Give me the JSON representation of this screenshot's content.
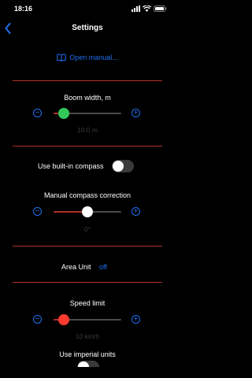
{
  "status": {
    "time": "18:16"
  },
  "nav": {
    "title": "Settings"
  },
  "manual": {
    "label": "Open manual..."
  },
  "boom": {
    "label": "Boom width, m",
    "value": "10.0 m",
    "fraction": 0.15,
    "thumb_color": "#33c759"
  },
  "compass": {
    "label": "Use built-in compass",
    "on": false
  },
  "correction": {
    "label": "Manual compass correction",
    "value": "0°",
    "fraction": 0.5,
    "thumb_color": "#ffffff"
  },
  "area": {
    "label": "Area Unit",
    "value": "off"
  },
  "speed": {
    "label": "Speed limit",
    "value": "10 km/h",
    "fraction": 0.15,
    "thumb_color": "#ff3b30"
  },
  "imperial": {
    "label": "Use imperial units"
  },
  "colors": {
    "accent": "#1e6ff0",
    "separator": "#b0302c",
    "min_track": "#b0302c",
    "max_track": "#4a4a4a"
  }
}
